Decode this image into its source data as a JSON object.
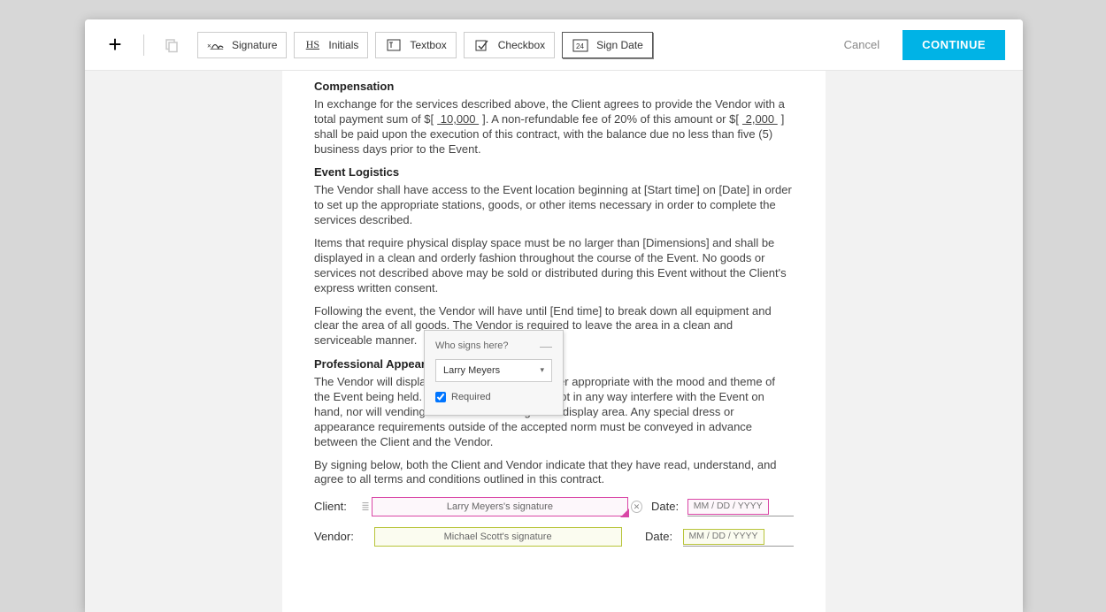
{
  "toolbar": {
    "buttons": {
      "signature": "Signature",
      "initials_code": "HS",
      "initials": "Initials",
      "textbox": "Textbox",
      "checkbox": "Checkbox",
      "sign_date_num": "24",
      "sign_date": "Sign Date"
    },
    "cancel": "Cancel",
    "continue": "CONTINUE"
  },
  "document": {
    "headings": {
      "compensation": "Compensation",
      "logistics": "Event Logistics",
      "appearance": "Professional Appearance"
    },
    "compensation_text_1": "In exchange for the services described above, the Client agrees to provide the Vendor with a total payment sum of $",
    "amount1": " 10,000            ",
    "compensation_text_2": ". A non-refundable fee of 20% of this amount or $",
    "amount2": " 2,000               ",
    "compensation_text_3": " shall be paid upon the execution of this contract, with the balance due no less than five (5) business days prior to the Event.",
    "logistics_p1": "The Vendor shall have access to the Event location beginning at [Start time] on [Date] in order to set up the appropriate stations, goods, or other items necessary in order to complete the services described.",
    "logistics_p2": "Items that require physical display space must be no larger than [Dimensions] and shall be displayed in a clean and orderly fashion throughout the course of the Event. No goods or services not described above may be sold or distributed during this Event without the Client's express written consent.",
    "logistics_p3": "Following the event, the Vendor will have until [End time] to break down all equipment and clear the area of all goods. The Vendor is required to leave the area in a clean and serviceable manner.",
    "appearance_p": "The Vendor will display him or herself in a manner appropriate with the mood and theme of the Event being held. The Vendor's display will not in any way interfere with the Event on hand, nor will vending staff leave the designated display area. Any special dress or appearance requirements outside of the accepted norm must be conveyed in advance between the Client and the Vendor.",
    "signing_p": "By signing below, both the Client and Vendor indicate that they have read, understand, and agree to all terms and conditions outlined in this contract.",
    "labels": {
      "client": "Client:",
      "vendor": "Vendor:",
      "date": "Date:"
    },
    "sig_client": "Larry Meyers's signature",
    "sig_vendor": "Michael Scott's signature",
    "date_placeholder": "MM / DD / YYYY"
  },
  "popup": {
    "title": "Who signs here?",
    "selected": "Larry Meyers",
    "required_label": "Required",
    "required_checked": true
  }
}
